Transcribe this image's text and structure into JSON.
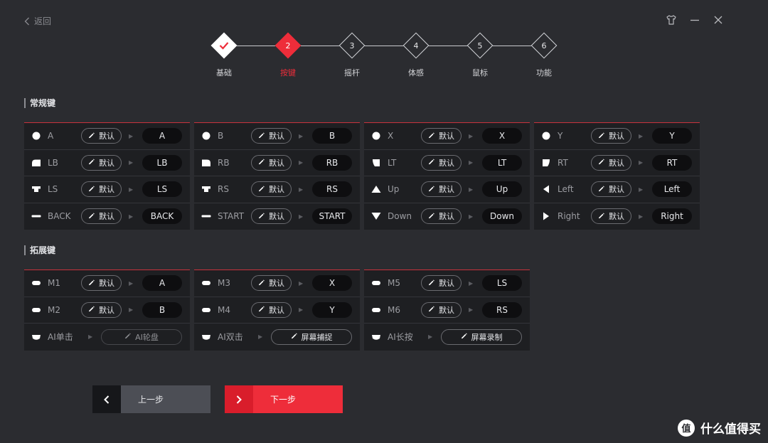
{
  "header": {
    "back_label": "返回"
  },
  "steps": [
    {
      "num": "",
      "label": "基础",
      "state": "done"
    },
    {
      "num": "2",
      "label": "按键",
      "state": "active"
    },
    {
      "num": "3",
      "label": "摇杆",
      "state": "todo"
    },
    {
      "num": "4",
      "label": "体感",
      "state": "todo"
    },
    {
      "num": "5",
      "label": "鼠标",
      "state": "todo"
    },
    {
      "num": "6",
      "label": "功能",
      "state": "todo"
    }
  ],
  "sections": {
    "regular": "常规键",
    "extended": "拓展键"
  },
  "regular_panels": [
    [
      {
        "icon": "circle-icon",
        "key": "A",
        "edit": "默认",
        "value": "A"
      },
      {
        "icon": "left-bumper-icon",
        "key": "LB",
        "edit": "默认",
        "value": "LB"
      },
      {
        "icon": "stick-press-icon",
        "key": "LS",
        "edit": "默认",
        "value": "LS"
      },
      {
        "icon": "bar-icon",
        "key": "BACK",
        "edit": "默认",
        "value": "BACK"
      }
    ],
    [
      {
        "icon": "circle-icon",
        "key": "B",
        "edit": "默认",
        "value": "B"
      },
      {
        "icon": "right-bumper-icon",
        "key": "RB",
        "edit": "默认",
        "value": "RB"
      },
      {
        "icon": "stick-press-icon",
        "key": "RS",
        "edit": "默认",
        "value": "RS"
      },
      {
        "icon": "bar-icon",
        "key": "START",
        "edit": "默认",
        "value": "START"
      }
    ],
    [
      {
        "icon": "circle-icon",
        "key": "X",
        "edit": "默认",
        "value": "X"
      },
      {
        "icon": "left-trigger-icon",
        "key": "LT",
        "edit": "默认",
        "value": "LT"
      },
      {
        "icon": "triangle-up-icon",
        "key": "Up",
        "edit": "默认",
        "value": "Up"
      },
      {
        "icon": "triangle-down-icon",
        "key": "Down",
        "edit": "默认",
        "value": "Down"
      }
    ],
    [
      {
        "icon": "circle-icon",
        "key": "Y",
        "edit": "默认",
        "value": "Y"
      },
      {
        "icon": "right-trigger-icon",
        "key": "RT",
        "edit": "默认",
        "value": "RT"
      },
      {
        "icon": "triangle-left-icon",
        "key": "Left",
        "edit": "默认",
        "value": "Left"
      },
      {
        "icon": "triangle-right-icon",
        "key": "Right",
        "edit": "默认",
        "value": "Right"
      }
    ]
  ],
  "extended_panels": [
    [
      {
        "icon": "pill-icon",
        "key": "M1",
        "edit": "默认",
        "value": "A"
      },
      {
        "icon": "pill-icon",
        "key": "M2",
        "edit": "默认",
        "value": "B"
      },
      {
        "icon": "ai-key-icon",
        "key": "AI单击",
        "edit": "AI轮盘",
        "wide": true,
        "disabled": true
      }
    ],
    [
      {
        "icon": "pill-icon",
        "key": "M3",
        "edit": "默认",
        "value": "X"
      },
      {
        "icon": "pill-icon",
        "key": "M4",
        "edit": "默认",
        "value": "Y"
      },
      {
        "icon": "ai-key-icon",
        "key": "AI双击",
        "edit": "屏幕捕捉",
        "wide": true
      }
    ],
    [
      {
        "icon": "pill-icon",
        "key": "M5",
        "edit": "默认",
        "value": "LS"
      },
      {
        "icon": "pill-icon",
        "key": "M6",
        "edit": "默认",
        "value": "RS"
      },
      {
        "icon": "ai-key-icon",
        "key": "AI长按",
        "edit": "屏幕录制",
        "wide": true
      }
    ]
  ],
  "nav": {
    "prev": "上一步",
    "next": "下一步"
  },
  "watermark": {
    "logo": "值",
    "text": "什么值得买"
  },
  "colors": {
    "accent": "#ee2d3a",
    "background": "#2b2c30",
    "panel": "#1e1f22"
  }
}
